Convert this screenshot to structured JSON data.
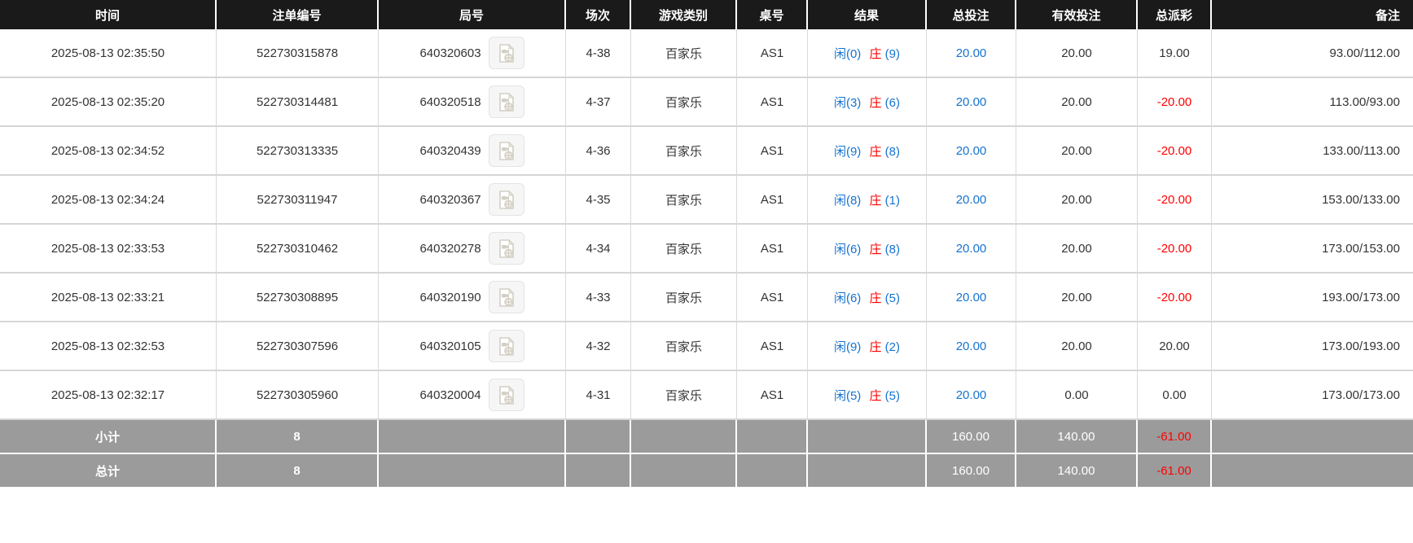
{
  "colors": {
    "header_bg": "#1a1a1a",
    "header_text": "#ffffff",
    "body_text": "#333333",
    "link_blue": "#1673cf",
    "negative_red": "#ff0000",
    "footer_bg": "#9b9b9b",
    "row_border": "#d6d6d6"
  },
  "icons": {
    "round_video_icon": "video-file-icon"
  },
  "table": {
    "columns": [
      {
        "label": "时间"
      },
      {
        "label": "注单编号"
      },
      {
        "label": "局号"
      },
      {
        "label": "场次"
      },
      {
        "label": "游戏类别"
      },
      {
        "label": "桌号"
      },
      {
        "label": "结果"
      },
      {
        "label": "总投注"
      },
      {
        "label": "有效投注"
      },
      {
        "label": "总派彩"
      },
      {
        "label": "备注"
      }
    ],
    "rows": [
      {
        "time": "2025-08-13 02:35:50",
        "bet_id": "522730315878",
        "round": "640320603",
        "session": "4-38",
        "game_type": "百家乐",
        "table_no": "AS1",
        "result": {
          "player": "闲(0)",
          "banker": "庄",
          "banker_score": "(9)"
        },
        "total_bet": "20.00",
        "valid_bet": "20.00",
        "payout": "19.00",
        "remark": "93.00/112.00"
      },
      {
        "time": "2025-08-13 02:35:20",
        "bet_id": "522730314481",
        "round": "640320518",
        "session": "4-37",
        "game_type": "百家乐",
        "table_no": "AS1",
        "result": {
          "player": "闲(3)",
          "banker": "庄",
          "banker_score": "(6)"
        },
        "total_bet": "20.00",
        "valid_bet": "20.00",
        "payout": "-20.00",
        "remark": "113.00/93.00"
      },
      {
        "time": "2025-08-13 02:34:52",
        "bet_id": "522730313335",
        "round": "640320439",
        "session": "4-36",
        "game_type": "百家乐",
        "table_no": "AS1",
        "result": {
          "player": "闲(9)",
          "banker": "庄",
          "banker_score": "(8)"
        },
        "total_bet": "20.00",
        "valid_bet": "20.00",
        "payout": "-20.00",
        "remark": "133.00/113.00"
      },
      {
        "time": "2025-08-13 02:34:24",
        "bet_id": "522730311947",
        "round": "640320367",
        "session": "4-35",
        "game_type": "百家乐",
        "table_no": "AS1",
        "result": {
          "player": "闲(8)",
          "banker": "庄",
          "banker_score": "(1)"
        },
        "total_bet": "20.00",
        "valid_bet": "20.00",
        "payout": "-20.00",
        "remark": "153.00/133.00"
      },
      {
        "time": "2025-08-13 02:33:53",
        "bet_id": "522730310462",
        "round": "640320278",
        "session": "4-34",
        "game_type": "百家乐",
        "table_no": "AS1",
        "result": {
          "player": "闲(6)",
          "banker": "庄",
          "banker_score": "(8)"
        },
        "total_bet": "20.00",
        "valid_bet": "20.00",
        "payout": "-20.00",
        "remark": "173.00/153.00"
      },
      {
        "time": "2025-08-13 02:33:21",
        "bet_id": "522730308895",
        "round": "640320190",
        "session": "4-33",
        "game_type": "百家乐",
        "table_no": "AS1",
        "result": {
          "player": "闲(6)",
          "banker": "庄",
          "banker_score": "(5)"
        },
        "total_bet": "20.00",
        "valid_bet": "20.00",
        "payout": "-20.00",
        "remark": "193.00/173.00"
      },
      {
        "time": "2025-08-13 02:32:53",
        "bet_id": "522730307596",
        "round": "640320105",
        "session": "4-32",
        "game_type": "百家乐",
        "table_no": "AS1",
        "result": {
          "player": "闲(9)",
          "banker": "庄",
          "banker_score": "(2)"
        },
        "total_bet": "20.00",
        "valid_bet": "20.00",
        "payout": "20.00",
        "remark": "173.00/193.00"
      },
      {
        "time": "2025-08-13 02:32:17",
        "bet_id": "522730305960",
        "round": "640320004",
        "session": "4-31",
        "game_type": "百家乐",
        "table_no": "AS1",
        "result": {
          "player": "闲(5)",
          "banker": "庄",
          "banker_score": "(5)"
        },
        "total_bet": "20.00",
        "valid_bet": "0.00",
        "payout": "0.00",
        "remark": "173.00/173.00"
      }
    ],
    "footer": [
      {
        "label": "小计",
        "count": "8",
        "total_bet": "160.00",
        "valid_bet": "140.00",
        "payout": "-61.00"
      },
      {
        "label": "总计",
        "count": "8",
        "total_bet": "160.00",
        "valid_bet": "140.00",
        "payout": "-61.00"
      }
    ]
  }
}
